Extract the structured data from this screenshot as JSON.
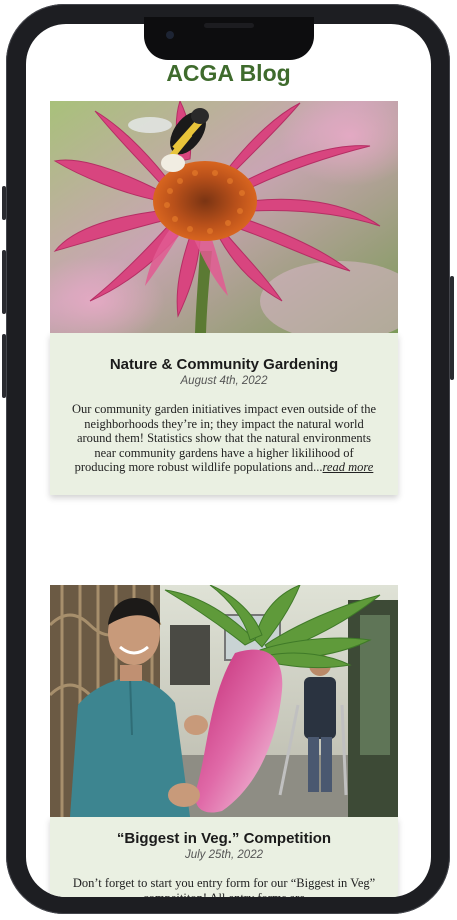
{
  "blog": {
    "title": "ACGA Blog"
  },
  "posts": [
    {
      "title": "Nature & Community Gardening",
      "date": "August 4th, 2022",
      "excerpt": "Our community garden initiatives impact even outside of the neighborhoods they’re in; they impact the natural world around them! Statistics show that the natural environments near community gardens have a higher likilihood of producing more robust wildlife populations and...",
      "read_more": "read more",
      "image": "bee-on-pink-coneflower"
    },
    {
      "title": "“Biggest in Veg.” Competition",
      "date": "July 25th, 2022",
      "excerpt": "Don’t forget to start you entry form for our “Biggest in Veg” compeititon! All entry forms are",
      "image": "man-holding-giant-radish"
    }
  ],
  "colors": {
    "brand_green": "#3f6b2d",
    "card_background": "#eaf0e2",
    "phone_frame": "#1d1e22"
  }
}
